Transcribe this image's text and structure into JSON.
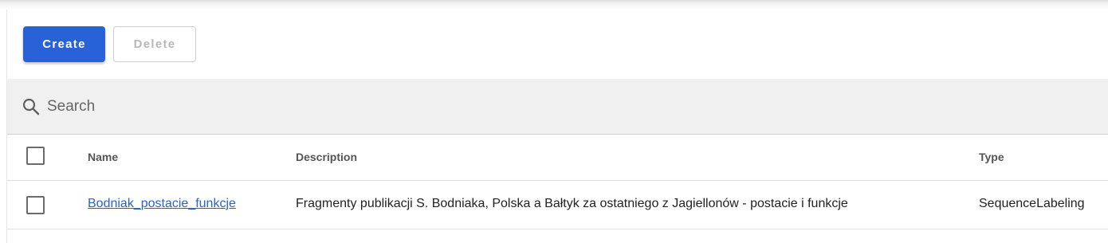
{
  "toolbar": {
    "create_label": "Create",
    "delete_label": "Delete"
  },
  "search": {
    "placeholder": "Search",
    "value": ""
  },
  "table": {
    "columns": {
      "name": "Name",
      "description": "Description",
      "type": "Type"
    },
    "rows": [
      {
        "name": "Bodniak_postacie_funkcje",
        "description": "Fragmenty publikacji S. Bodniaka, Polska a Bałtyk za ostatniego z Jagiellonów - postacie i funkcje",
        "type": "SequenceLabeling",
        "selected": false
      }
    ],
    "select_all": false
  },
  "colors": {
    "primary": "#2962d8",
    "search_bg": "#f0f0f0",
    "disabled_text": "#b8b8b8"
  }
}
